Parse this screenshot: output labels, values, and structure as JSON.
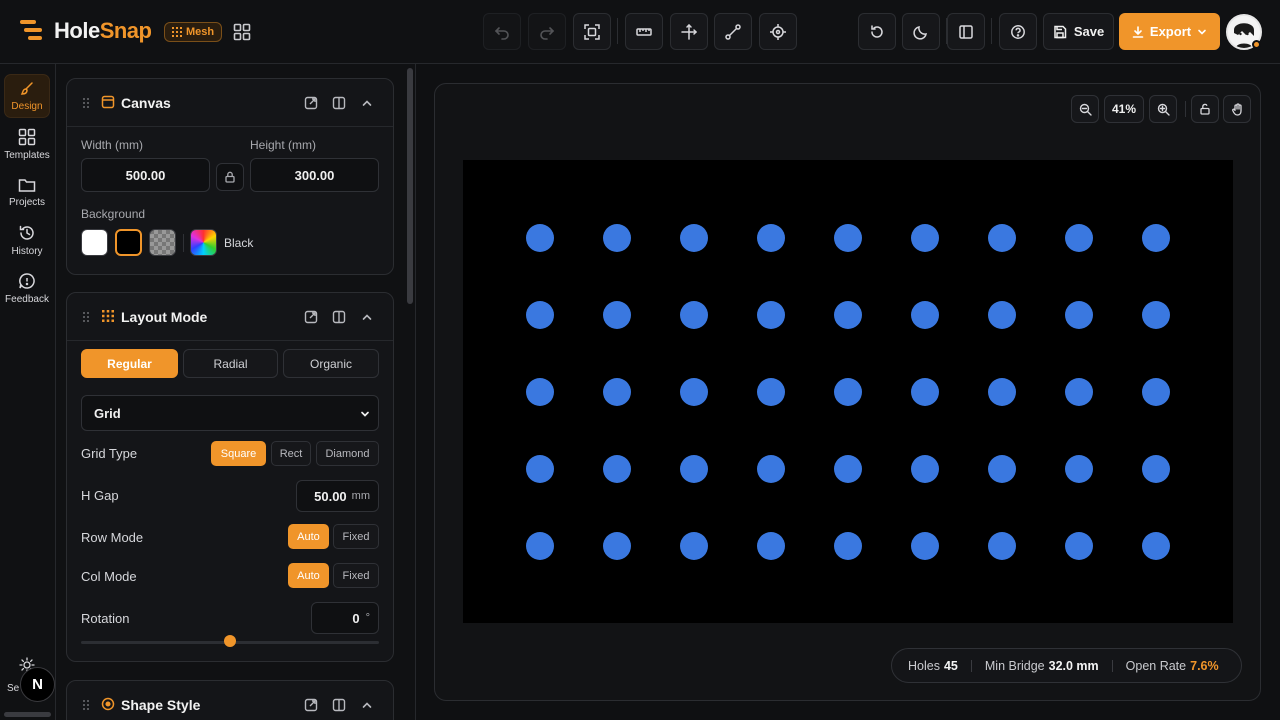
{
  "app": {
    "brand_part1": "Hole",
    "brand_part2": "Snap",
    "mode_badge": "Mesh",
    "accent_color": "#f0952a",
    "hole_color": "#3a78e0"
  },
  "toolbar": {
    "save_label": "Save",
    "export_label": "Export",
    "tools": [
      "undo-icon",
      "redo-icon",
      "fit-frame-icon",
      "ruler-icon",
      "move-icon",
      "path-icon",
      "target-icon"
    ],
    "right_tools": [
      "reset-icon",
      "moon-icon",
      "sidebar-icon",
      "help-icon"
    ]
  },
  "rail": {
    "items": [
      {
        "label": "Design",
        "icon": "brush-icon",
        "active": true
      },
      {
        "label": "Templates",
        "icon": "grid-icon",
        "active": false
      },
      {
        "label": "Projects",
        "icon": "folder-icon",
        "active": false
      },
      {
        "label": "History",
        "icon": "history-icon",
        "active": false
      },
      {
        "label": "Feedback",
        "icon": "chat-icon",
        "active": false
      }
    ],
    "bottom_label": "Se",
    "user_initial": "N"
  },
  "canvas_panel": {
    "title": "Canvas",
    "width_label": "Width (mm)",
    "height_label": "Height (mm)",
    "width_value": "500.00",
    "height_value": "300.00",
    "background_label": "Background",
    "background_value": "Black"
  },
  "layout_panel": {
    "title": "Layout Mode",
    "modes": [
      "Regular",
      "Radial",
      "Organic"
    ],
    "active_mode": "Regular",
    "pattern_select": "Grid",
    "grid_type_label": "Grid Type",
    "grid_types": [
      "Square",
      "Rect",
      "Diamond"
    ],
    "active_grid_type": "Square",
    "hgap_label": "H Gap",
    "hgap_value": "50.00",
    "hgap_unit": "mm",
    "row_mode_label": "Row Mode",
    "col_mode_label": "Col Mode",
    "mode_options": [
      "Auto",
      "Fixed"
    ],
    "row_mode": "Auto",
    "col_mode": "Auto",
    "rotation_label": "Rotation",
    "rotation_value": "0",
    "rotation_unit": "°",
    "rotation_slider_fraction": 0.5
  },
  "shape_panel": {
    "title": "Shape Style"
  },
  "stage": {
    "zoom": "41%",
    "grid_rows": 5,
    "grid_cols": 9
  },
  "stats": {
    "holes_label": "Holes",
    "holes_value": "45",
    "bridge_label": "Min Bridge",
    "bridge_value": "32.0 mm",
    "open_rate_label": "Open Rate",
    "open_rate_value": "7.6%"
  }
}
